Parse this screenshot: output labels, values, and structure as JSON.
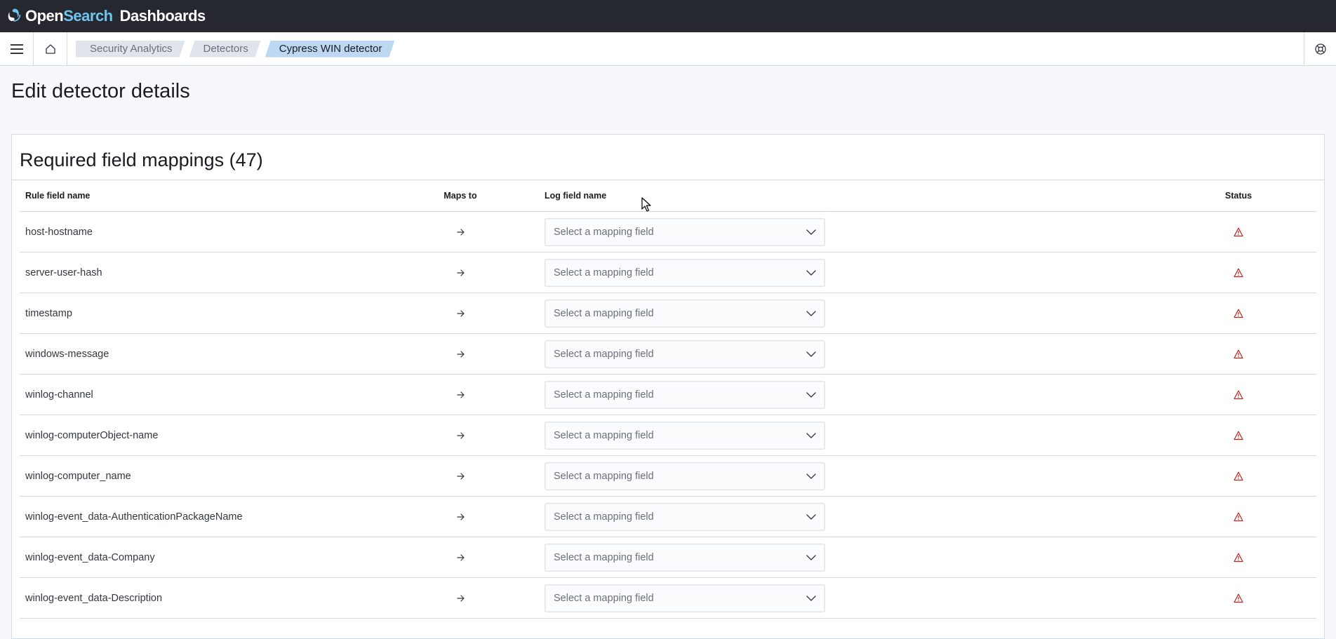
{
  "header": {
    "logo_open": "Open",
    "logo_search": "Search",
    "logo_dashboards": "Dashboards"
  },
  "breadcrumbs": [
    "Security Analytics",
    "Detectors",
    "Cypress WIN detector"
  ],
  "page": {
    "title": "Edit detector details"
  },
  "panel": {
    "title": "Required field mappings (47)"
  },
  "table": {
    "headers": {
      "rule_field": "Rule field name",
      "maps_to": "Maps to",
      "log_field": "Log field name",
      "status": "Status"
    },
    "rows": [
      {
        "rule_field": "host-hostname",
        "placeholder": "Select a mapping field",
        "status": "warning"
      },
      {
        "rule_field": "server-user-hash",
        "placeholder": "Select a mapping field",
        "status": "warning"
      },
      {
        "rule_field": "timestamp",
        "placeholder": "Select a mapping field",
        "status": "warning"
      },
      {
        "rule_field": "windows-message",
        "placeholder": "Select a mapping field",
        "status": "warning"
      },
      {
        "rule_field": "winlog-channel",
        "placeholder": "Select a mapping field",
        "status": "warning"
      },
      {
        "rule_field": "winlog-computerObject-name",
        "placeholder": "Select a mapping field",
        "status": "warning"
      },
      {
        "rule_field": "winlog-computer_name",
        "placeholder": "Select a mapping field",
        "status": "warning"
      },
      {
        "rule_field": "winlog-event_data-AuthenticationPackageName",
        "placeholder": "Select a mapping field",
        "status": "warning"
      },
      {
        "rule_field": "winlog-event_data-Company",
        "placeholder": "Select a mapping field",
        "status": "warning"
      },
      {
        "rule_field": "winlog-event_data-Description",
        "placeholder": "Select a mapping field",
        "status": "warning"
      }
    ]
  },
  "colors": {
    "header_bg": "#25282f",
    "accent_blue": "#6ec5ef",
    "active_crumb": "#bcd8f2",
    "warning_red": "#bd271e"
  },
  "icons": [
    "menu-icon",
    "home-icon",
    "help-icon",
    "arrow-right-icon",
    "chevron-down-icon",
    "warning-icon"
  ]
}
